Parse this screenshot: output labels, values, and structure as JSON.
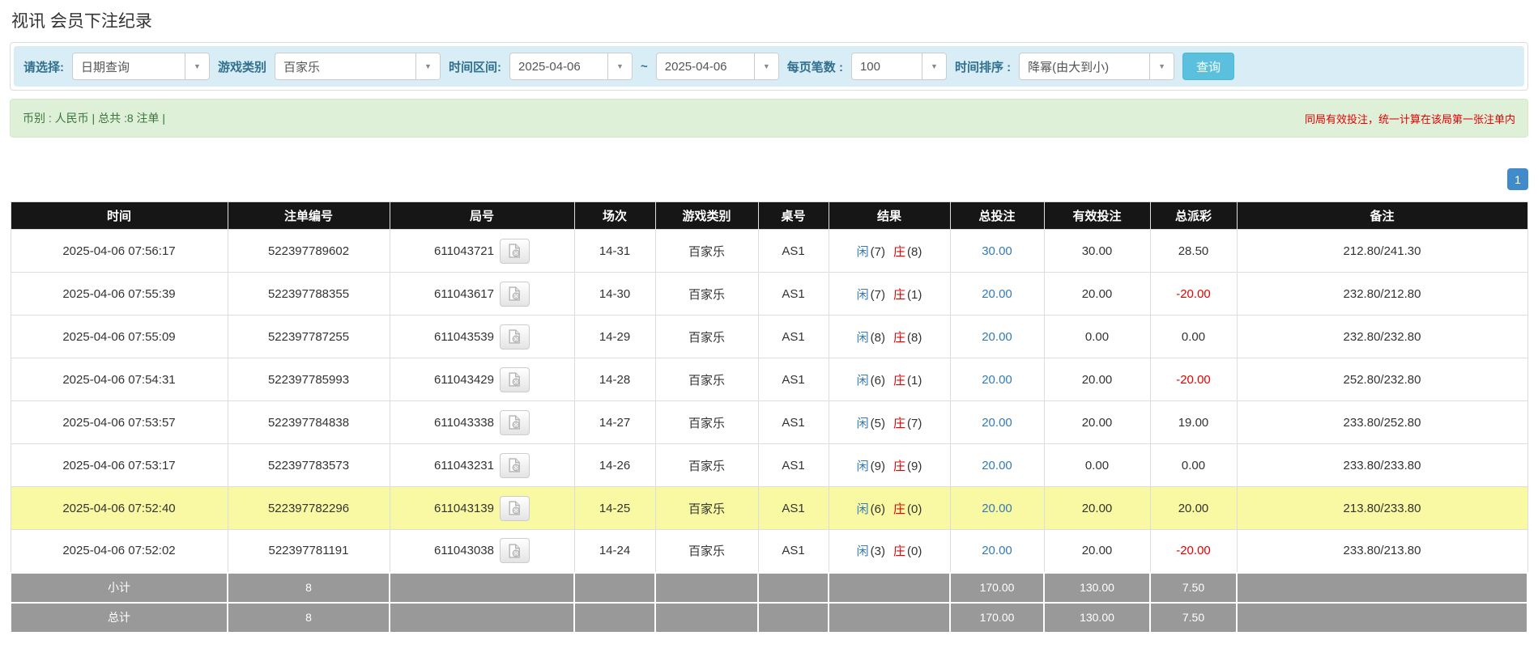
{
  "page_title": "视讯 会员下注纪录",
  "filters": {
    "select_label": "请选择:",
    "select_value": "日期查询",
    "game_type_label": "游戏类别",
    "game_type_value": "百家乐",
    "time_range_label": "时间区间:",
    "date_from": "2025-04-06",
    "tilde": "~",
    "date_to": "2025-04-06",
    "page_size_label": "每页笔数 :",
    "page_size_value": "100",
    "sort_label": "时间排序 :",
    "sort_value": "降幂(由大到小)",
    "search_button": "查询"
  },
  "summary": {
    "left_text": "币别 : 人民币 | 总共 :8 注单 |",
    "right_note": "同局有效投注，统一计算在该局第一张注单内"
  },
  "pagination": {
    "current_page": "1"
  },
  "table": {
    "headers": [
      "时间",
      "注单编号",
      "局号",
      "场次",
      "游戏类别",
      "桌号",
      "结果",
      "总投注",
      "有效投注",
      "总派彩",
      "备注"
    ],
    "result_labels": {
      "player": "闲",
      "banker": "庄"
    },
    "rows": [
      {
        "time": "2025-04-06 07:56:17",
        "bet_id": "522397789602",
        "round_id": "611043721",
        "session": "14-31",
        "game": "百家乐",
        "table_no": "AS1",
        "player_score": "(7)",
        "banker_score": "(8)",
        "total_bet": "30.00",
        "valid_bet": "30.00",
        "payout": "28.50",
        "payout_negative": false,
        "note": "212.80/241.30",
        "highlight": false
      },
      {
        "time": "2025-04-06 07:55:39",
        "bet_id": "522397788355",
        "round_id": "611043617",
        "session": "14-30",
        "game": "百家乐",
        "table_no": "AS1",
        "player_score": "(7)",
        "banker_score": "(1)",
        "total_bet": "20.00",
        "valid_bet": "20.00",
        "payout": "-20.00",
        "payout_negative": true,
        "note": "232.80/212.80",
        "highlight": false
      },
      {
        "time": "2025-04-06 07:55:09",
        "bet_id": "522397787255",
        "round_id": "611043539",
        "session": "14-29",
        "game": "百家乐",
        "table_no": "AS1",
        "player_score": "(8)",
        "banker_score": "(8)",
        "total_bet": "20.00",
        "valid_bet": "0.00",
        "payout": "0.00",
        "payout_negative": false,
        "note": "232.80/232.80",
        "highlight": false
      },
      {
        "time": "2025-04-06 07:54:31",
        "bet_id": "522397785993",
        "round_id": "611043429",
        "session": "14-28",
        "game": "百家乐",
        "table_no": "AS1",
        "player_score": "(6)",
        "banker_score": "(1)",
        "total_bet": "20.00",
        "valid_bet": "20.00",
        "payout": "-20.00",
        "payout_negative": true,
        "note": "252.80/232.80",
        "highlight": false
      },
      {
        "time": "2025-04-06 07:53:57",
        "bet_id": "522397784838",
        "round_id": "611043338",
        "session": "14-27",
        "game": "百家乐",
        "table_no": "AS1",
        "player_score": "(5)",
        "banker_score": "(7)",
        "total_bet": "20.00",
        "valid_bet": "20.00",
        "payout": "19.00",
        "payout_negative": false,
        "note": "233.80/252.80",
        "highlight": false
      },
      {
        "time": "2025-04-06 07:53:17",
        "bet_id": "522397783573",
        "round_id": "611043231",
        "session": "14-26",
        "game": "百家乐",
        "table_no": "AS1",
        "player_score": "(9)",
        "banker_score": "(9)",
        "total_bet": "20.00",
        "valid_bet": "0.00",
        "payout": "0.00",
        "payout_negative": false,
        "note": "233.80/233.80",
        "highlight": false
      },
      {
        "time": "2025-04-06 07:52:40",
        "bet_id": "522397782296",
        "round_id": "611043139",
        "session": "14-25",
        "game": "百家乐",
        "table_no": "AS1",
        "player_score": "(6)",
        "banker_score": "(0)",
        "total_bet": "20.00",
        "valid_bet": "20.00",
        "payout": "20.00",
        "payout_negative": false,
        "note": "213.80/233.80",
        "highlight": true
      },
      {
        "time": "2025-04-06 07:52:02",
        "bet_id": "522397781191",
        "round_id": "611043038",
        "session": "14-24",
        "game": "百家乐",
        "table_no": "AS1",
        "player_score": "(3)",
        "banker_score": "(0)",
        "total_bet": "20.00",
        "valid_bet": "20.00",
        "payout": "-20.00",
        "payout_negative": true,
        "note": "233.80/213.80",
        "highlight": false
      }
    ],
    "subtotal": {
      "label": "小计",
      "count": "8",
      "total_bet": "170.00",
      "valid_bet": "130.00",
      "payout": "7.50"
    },
    "total": {
      "label": "总计",
      "count": "8",
      "total_bet": "170.00",
      "valid_bet": "130.00",
      "payout": "7.50"
    }
  },
  "colors": {
    "accent_blue": "#337ab7",
    "negative_red": "#e60000",
    "query_button": "#5bc0de",
    "filter_bg": "#d9edf7",
    "alert_bg": "#dff0d8",
    "alert_text": "#3c763d",
    "header_bg": "#161616",
    "footer_bg": "#999999",
    "highlight_row": "#f9f9a3"
  }
}
